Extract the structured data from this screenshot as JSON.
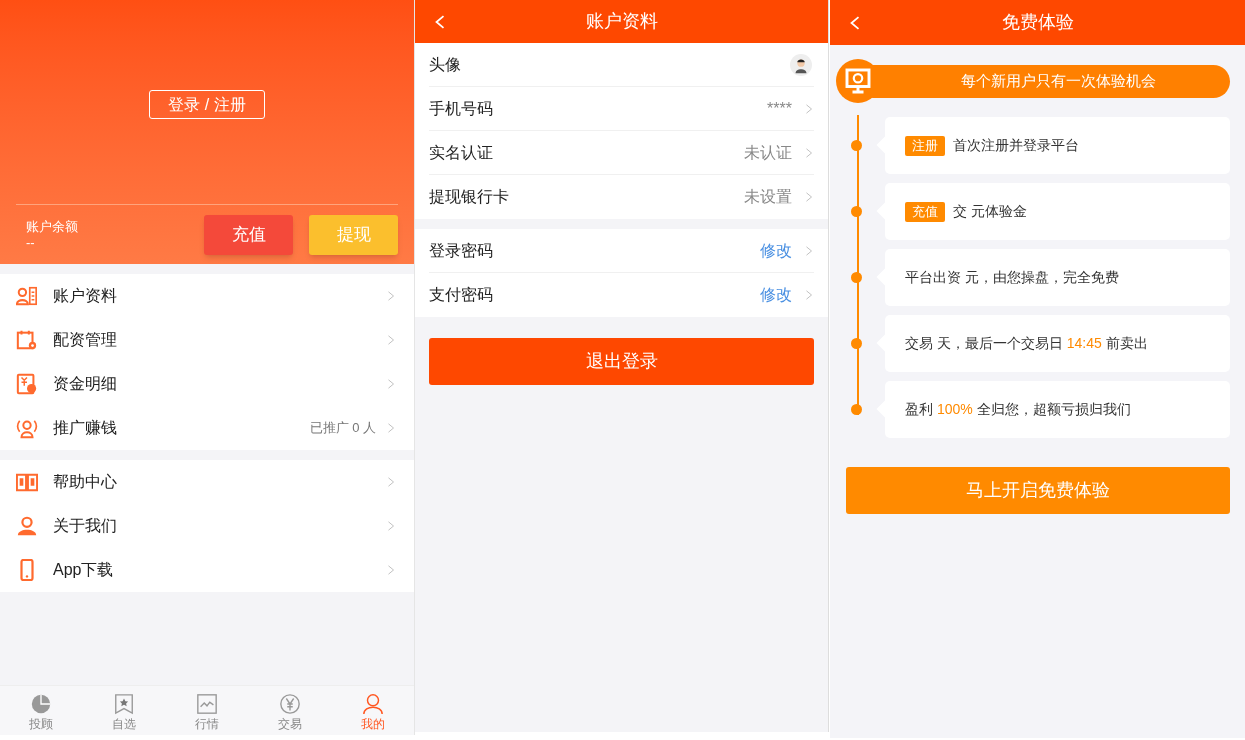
{
  "account_panel": {
    "login_button": "登录 / 注册",
    "balance_label": "账户余额",
    "balance_value": "--",
    "buttons": [
      {
        "label": "充值",
        "kind": "recharge"
      },
      {
        "label": "提现",
        "kind": "withdraw"
      }
    ],
    "menu_groups": [
      [
        {
          "kind": "profile",
          "label": "账户资料"
        },
        {
          "kind": "funding",
          "label": "配资管理"
        },
        {
          "kind": "ledger",
          "label": "资金明细"
        },
        {
          "kind": "promote",
          "label": "推广赚钱",
          "note": "已推广 0 人"
        }
      ],
      [
        {
          "kind": "help",
          "label": "帮助中心"
        },
        {
          "kind": "about",
          "label": "关于我们"
        },
        {
          "kind": "app",
          "label": "App下载"
        }
      ]
    ],
    "tab_bar": [
      {
        "kind": "advisor",
        "label": "投顾",
        "selected": false
      },
      {
        "kind": "watchlist",
        "label": "自选",
        "selected": false
      },
      {
        "kind": "market",
        "label": "行情",
        "selected": false
      },
      {
        "kind": "trade",
        "label": "交易",
        "selected": false
      },
      {
        "kind": "mine",
        "label": "我的",
        "selected": true
      }
    ]
  },
  "profile_panel": {
    "title": "账户资料",
    "groups": [
      [
        {
          "kind": "avatar",
          "label": "头像"
        },
        {
          "kind": "value",
          "label": "手机号码",
          "value": "****"
        },
        {
          "kind": "value",
          "label": "实名认证",
          "value": "未认证"
        },
        {
          "kind": "value",
          "label": "提现银行卡",
          "value": "未设置"
        }
      ],
      [
        {
          "kind": "link",
          "label": "登录密码",
          "value": "修改"
        },
        {
          "kind": "link",
          "label": "支付密码",
          "value": "修改"
        }
      ]
    ],
    "logout_button": "退出登录"
  },
  "trial_panel": {
    "title": "免费体验",
    "banner": "每个新用户只有一次体验机会",
    "steps": [
      {
        "tag": "注册",
        "parts": [
          {
            "text": "首次注册并登录平台",
            "highlight": false
          }
        ]
      },
      {
        "tag": "充值",
        "parts": [
          {
            "text": "交 元体验金",
            "highlight": false
          }
        ]
      },
      {
        "parts": [
          {
            "text": "平台出资 元，由您操盘，完全免费",
            "highlight": false
          }
        ]
      },
      {
        "parts": [
          {
            "text": "交易 天，最后一个交易日 ",
            "highlight": false
          },
          {
            "text": "14:45",
            "highlight": true
          },
          {
            "text": " 前卖出",
            "highlight": false
          }
        ]
      },
      {
        "parts": [
          {
            "text": "盈利 ",
            "highlight": false
          },
          {
            "text": "100%",
            "highlight": true
          },
          {
            "text": " 全归您，超额亏损归我们",
            "highlight": false
          }
        ]
      }
    ],
    "start_button": "马上开启免费体验"
  }
}
